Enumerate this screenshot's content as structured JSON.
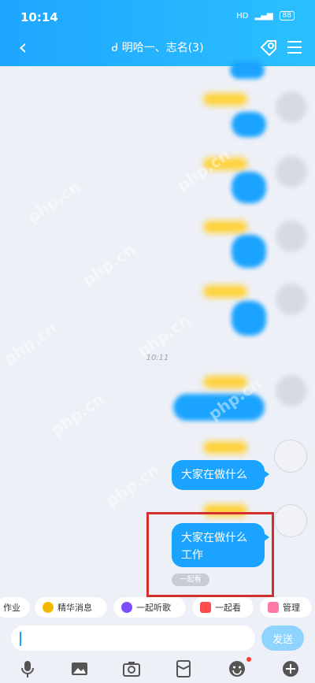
{
  "status": {
    "time": "10:14",
    "network": "HD",
    "battery": "88"
  },
  "header": {
    "title": "ᑯ 明哈一、志名(3)"
  },
  "chat": {
    "timestamp": "10:11",
    "messages": [
      {
        "text": "大家在做什么"
      },
      {
        "text": "大家在做什么工作"
      }
    ],
    "receipt": "一起看",
    "watermark": "php.cn"
  },
  "quick_actions": [
    {
      "label": "作业"
    },
    {
      "label": "精华消息"
    },
    {
      "label": "一起听歌"
    },
    {
      "label": "一起看"
    },
    {
      "label": "管理"
    }
  ],
  "composer": {
    "value": "",
    "send_label": "发送"
  },
  "toolbar": [
    {
      "icon": "mic-icon"
    },
    {
      "icon": "image-icon"
    },
    {
      "icon": "camera-icon"
    },
    {
      "icon": "red-packet-icon"
    },
    {
      "icon": "emoji-icon"
    },
    {
      "icon": "plus-icon"
    }
  ],
  "colors": {
    "accent": "#1aa3ff",
    "header": "#1ea6ff",
    "highlight": "#d32f2f",
    "name": "#ffd23c"
  }
}
